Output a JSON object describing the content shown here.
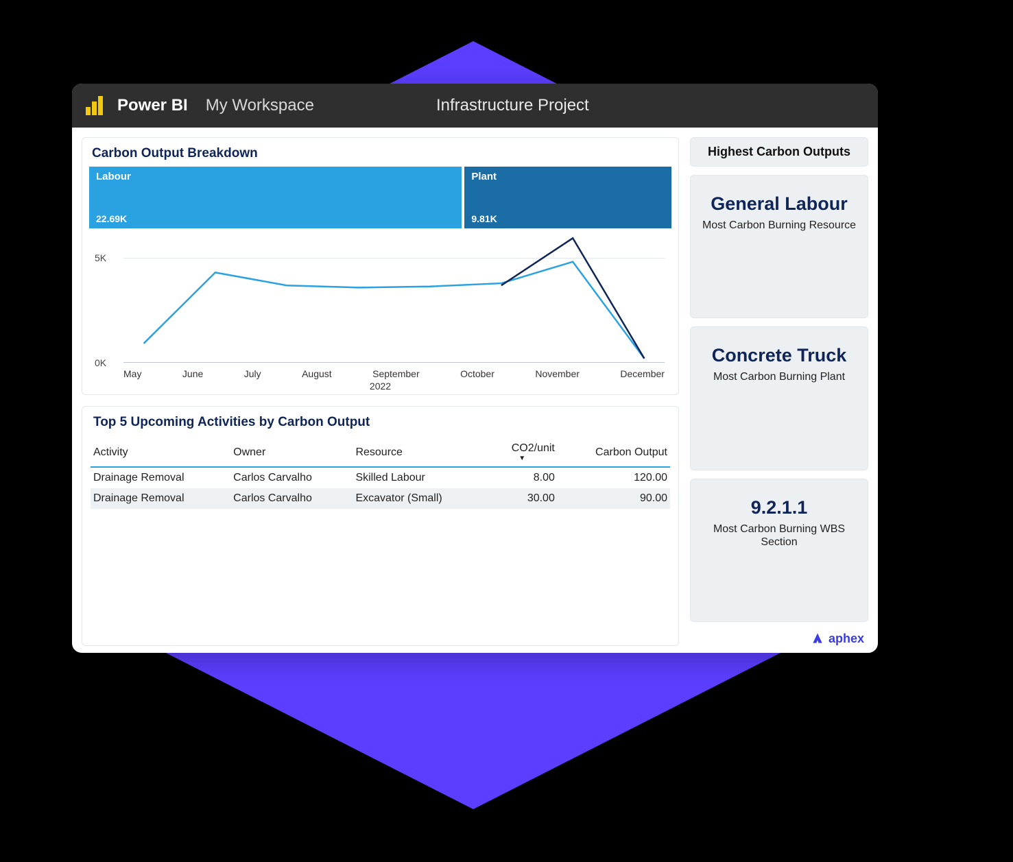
{
  "header": {
    "app": "Power BI",
    "workspace": "My Workspace",
    "project": "Infrastructure Project"
  },
  "breakdown": {
    "title": "Carbon Output Breakdown",
    "segments": [
      {
        "label": "Labour",
        "value": "22.69K"
      },
      {
        "label": "Plant",
        "value": "9.81K"
      }
    ]
  },
  "chart_data": {
    "type": "line",
    "categories": [
      "May",
      "June",
      "July",
      "August",
      "September",
      "October",
      "November",
      "December"
    ],
    "year": "2022",
    "ylabel": "",
    "yticks": [
      "5K",
      "0K"
    ],
    "ylim": [
      0,
      6000
    ],
    "series": [
      {
        "name": "Labour",
        "color": "#2aa1e0",
        "values": [
          900,
          4200,
          3600,
          3500,
          3550,
          3700,
          4700,
          200
        ]
      },
      {
        "name": "Plant",
        "color": "#0f2557",
        "values": [
          null,
          null,
          null,
          null,
          null,
          3600,
          5800,
          200
        ]
      }
    ]
  },
  "activities": {
    "title": "Top 5 Upcoming Activities by Carbon Output",
    "columns": {
      "activity": "Activity",
      "owner": "Owner",
      "resource": "Resource",
      "co2": "CO2/unit",
      "output": "Carbon Output"
    },
    "rows": [
      {
        "activity": "Drainage Removal",
        "owner": "Carlos Carvalho",
        "resource": "Skilled Labour",
        "co2": "8.00",
        "output": "120.00"
      },
      {
        "activity": "Drainage Removal",
        "owner": "Carlos Carvalho",
        "resource": "Excavator (Small)",
        "co2": "30.00",
        "output": "90.00"
      }
    ]
  },
  "sidebar": {
    "header": "Highest Carbon Outputs",
    "cards": [
      {
        "value": "General Labour",
        "label": "Most Carbon Burning Resource"
      },
      {
        "value": "Concrete Truck",
        "label": "Most Carbon Burning Plant"
      },
      {
        "value": "9.2.1.1",
        "label": "Most Carbon Burning WBS Section"
      }
    ]
  },
  "brand": "aphex"
}
